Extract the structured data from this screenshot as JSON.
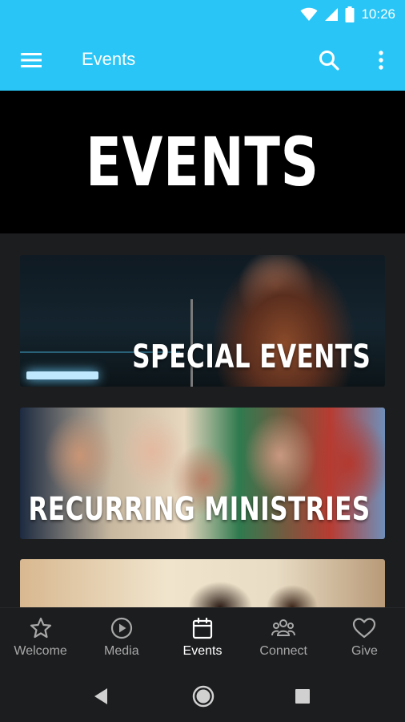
{
  "status_bar": {
    "time": "10:26"
  },
  "app_bar": {
    "title": "Events"
  },
  "hero": {
    "title": "EVENTS"
  },
  "cards": [
    {
      "label": "SPECIAL EVENTS"
    },
    {
      "label": "RECURRING MINISTRIES"
    },
    {
      "label": ""
    }
  ],
  "bottom_nav": {
    "items": [
      {
        "label": "Welcome",
        "icon": "star-icon"
      },
      {
        "label": "Media",
        "icon": "play-circle-icon"
      },
      {
        "label": "Events",
        "icon": "calendar-icon",
        "active": true
      },
      {
        "label": "Connect",
        "icon": "group-icon"
      },
      {
        "label": "Give",
        "icon": "heart-icon"
      }
    ]
  },
  "colors": {
    "accent": "#29c5f6",
    "background": "#1c1d1f",
    "hero_bg": "#000000",
    "nav_inactive": "#a8a8a8",
    "nav_active": "#ffffff"
  }
}
